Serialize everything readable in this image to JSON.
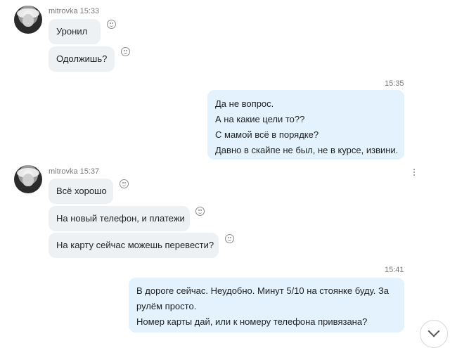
{
  "groups": [
    {
      "sender": "mitrovka",
      "time": "15:33",
      "messages": [
        "Уронил",
        "Одолжишь?"
      ]
    },
    {
      "time": "15:35",
      "lines": [
        "Да не вопрос.",
        "А на какие цели то??",
        "С мамой всё в порядке?",
        "Давно в скайпе не был, не в курсе, извини."
      ]
    },
    {
      "sender": "mitrovka",
      "time": "15:37",
      "messages": [
        "Всё хорошо",
        "На новый телефон, и платежи",
        "На карту сейчас можешь перевести?"
      ]
    },
    {
      "time": "15:41",
      "lines": [
        "В дороге сейчас. Неудобно. Минут 5/10 на стоянке буду. За",
        "рулём просто.",
        "Номер карты дай, или к номеру телефона привязана?"
      ]
    }
  ],
  "icons": {
    "reaction": "smiley-icon",
    "more": "more-vertical-icon",
    "scroll": "chevron-down-icon"
  }
}
